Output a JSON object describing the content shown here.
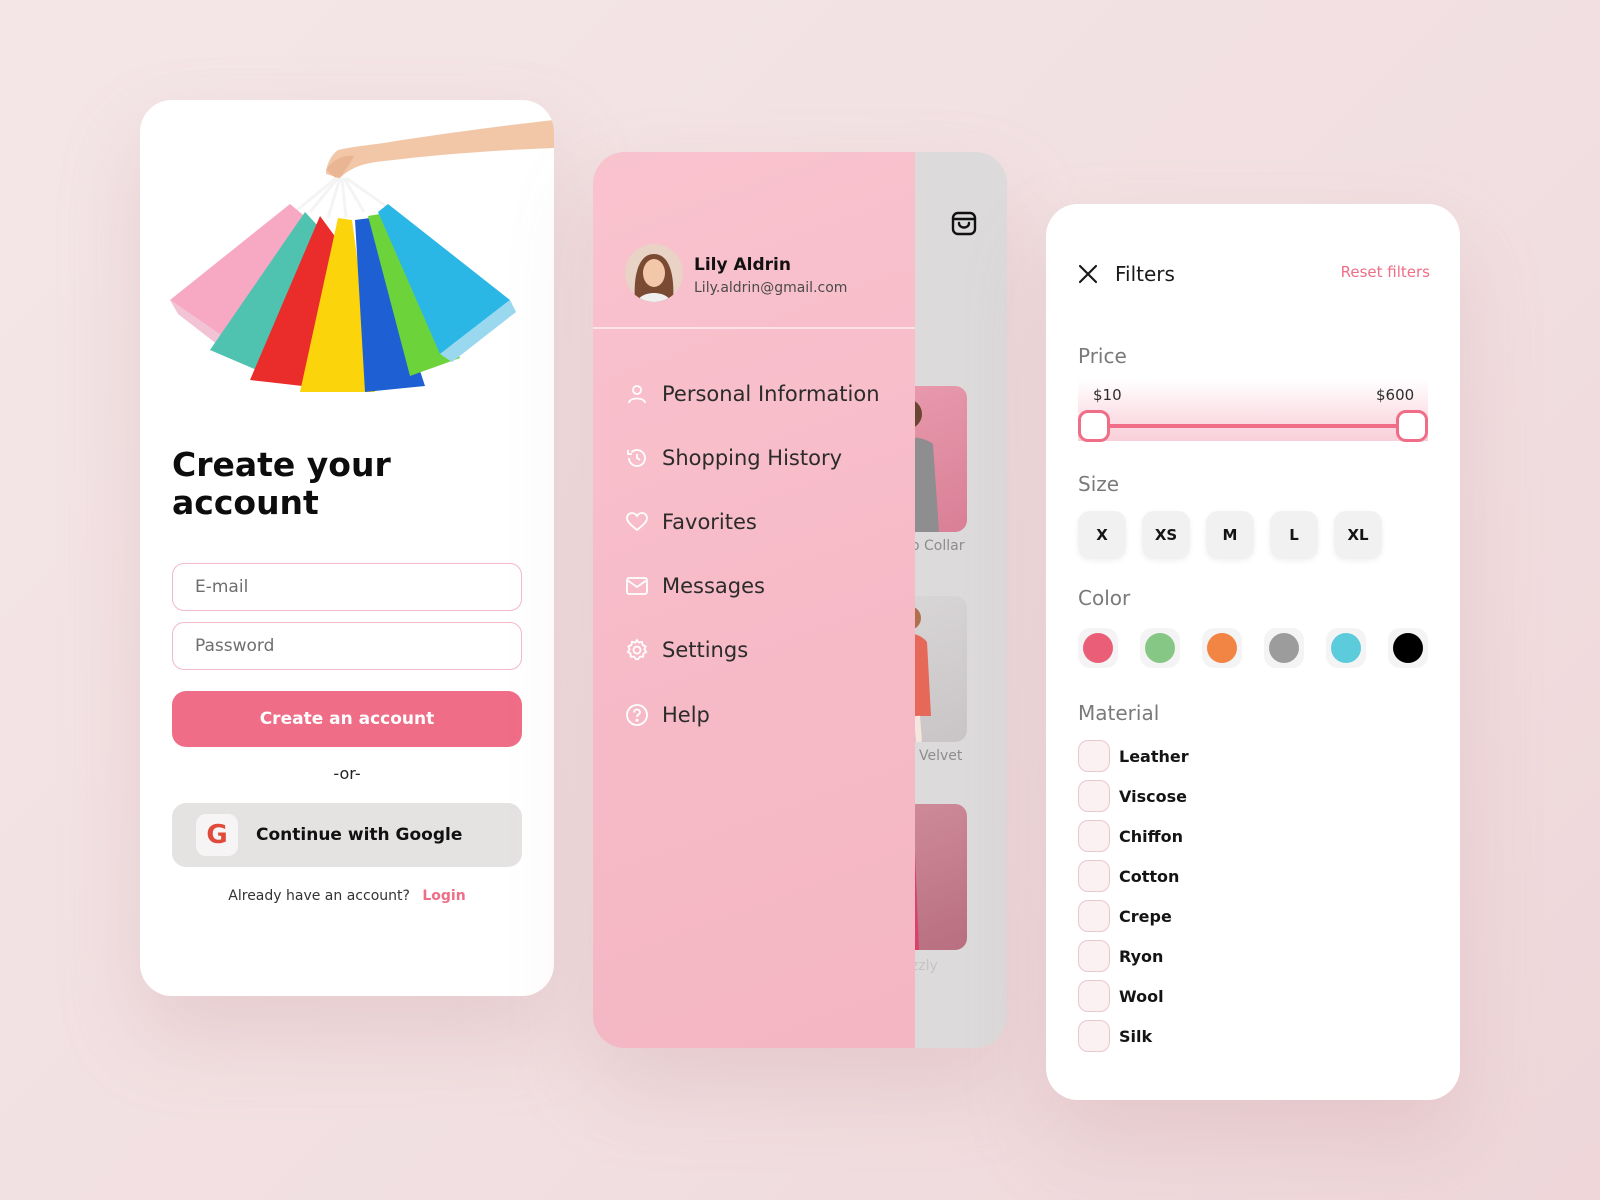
{
  "signup": {
    "title": "Create your account",
    "email_placeholder": "E-mail",
    "password_placeholder": "Password",
    "create_button": "Create an account",
    "or": "-or-",
    "google_letter": "G",
    "google_button": "Continue with Google",
    "already_text": "Already have an account?",
    "login_link": "Login"
  },
  "drawer": {
    "user": {
      "name": "Lily Aldrin",
      "email": "Lily.aldrin@gmail.com"
    },
    "items": [
      {
        "label": "Personal Information",
        "icon": "person-icon"
      },
      {
        "label": "Shopping History",
        "icon": "history-icon"
      },
      {
        "label": "Favorites",
        "icon": "heart-icon"
      },
      {
        "label": "Messages",
        "icon": "mail-icon"
      },
      {
        "label": "Settings",
        "icon": "gear-icon"
      },
      {
        "label": "Help",
        "icon": "help-icon"
      }
    ],
    "background_products": [
      {
        "caption": "o Collar"
      },
      {
        "caption": "Velvet"
      },
      {
        "caption": "izzly"
      }
    ]
  },
  "filters": {
    "title": "Filters",
    "reset": "Reset filters",
    "price": {
      "label": "Price",
      "min_label": "$10",
      "max_label": "$600"
    },
    "size": {
      "label": "Size",
      "options": [
        "X",
        "XS",
        "M",
        "L",
        "XL"
      ]
    },
    "color": {
      "label": "Color",
      "options": [
        "#ea5e78",
        "#86c785",
        "#f28444",
        "#9c9c9c",
        "#5ccbdb",
        "#000000"
      ]
    },
    "material": {
      "label": "Material",
      "options": [
        "Leather",
        "Viscose",
        "Chiffon",
        "Cotton",
        "Crepe",
        "Ryon",
        "Wool",
        "Silk"
      ]
    }
  },
  "theme": {
    "accent": "#f06d87",
    "drawer_pink": "#f8bfcb"
  }
}
